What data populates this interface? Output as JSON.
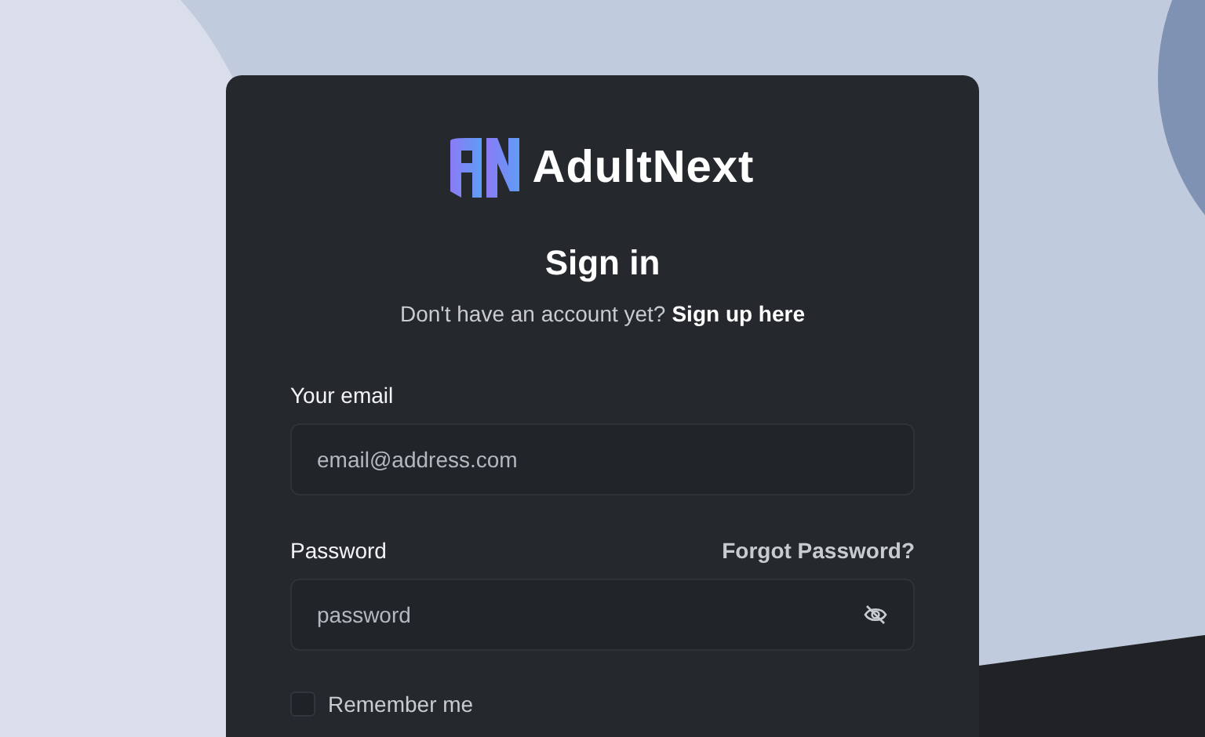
{
  "logo": {
    "name": "AdultNext"
  },
  "title": "Sign in",
  "subtitle": {
    "text": "Don't have an account yet?",
    "link": "Sign up here"
  },
  "email": {
    "label": "Your email",
    "placeholder": "email@address.com"
  },
  "password": {
    "label": "Password",
    "link": "Forgot Password?",
    "placeholder": "password"
  },
  "remember": {
    "label": "Remember me",
    "checked": false
  }
}
